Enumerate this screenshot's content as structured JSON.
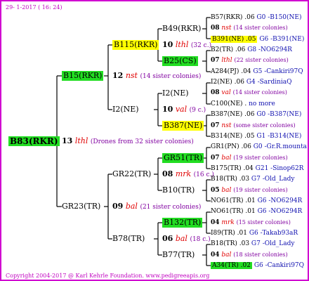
{
  "date": "29- 1-2017 ( 16: 24)",
  "copyright": "Copyright 2004-2017 @ Karl Kehrle Foundation.   www.pedigreeapis.org",
  "root": {
    "label": "B83(RKR)",
    "gen": "13",
    "mark": "lthl",
    "note": "(Drones from 32 sister colonies)"
  },
  "g1": [
    {
      "label": "B15(RKR)",
      "gen": "12",
      "mark": "nst",
      "note": "(14 sister colonies)"
    },
    {
      "label": "GR23(TR)",
      "gen": "09",
      "mark": "bal",
      "note": "(21 sister colonies)"
    }
  ],
  "g2": [
    {
      "label": "B115(RKR)",
      "gen": "10",
      "mark": "lthl",
      "note": "(32 c.)"
    },
    {
      "label": "I2(NE)",
      "gen": "10",
      "mark": "val",
      "note": "(9 c.)"
    },
    {
      "label": "GR22(TR)",
      "gen": "08",
      "mark": "mrk",
      "note": "(16 c.)"
    },
    {
      "label": "B78(TR)",
      "gen": "06",
      "mark": "bal",
      "note": "(18 c.)"
    }
  ],
  "g3": [
    {
      "label": "B49(RKR)"
    },
    {
      "label": "B25(CS)"
    },
    {
      "label": "I2(NE)"
    },
    {
      "label": "B387(NE)"
    },
    {
      "label": "GR51(TR)"
    },
    {
      "label": "B10(TR)"
    },
    {
      "label": "B132(TR)"
    },
    {
      "label": "B77(TR)"
    }
  ],
  "g4": [
    {
      "a": "B57(RKR) .06",
      "b": "G0 -B150(NE)"
    },
    {
      "gen": "08",
      "mark": "nst",
      "note": "(14 sister colonies)"
    },
    {
      "a": "B391(NE) .05",
      "b": "G6 -B391(NE)"
    },
    {
      "a": "B2(TR) .06",
      "b": "G8 -NO6294R"
    },
    {
      "gen": "07",
      "mark": "lthl",
      "note": "(22 sister colonies)"
    },
    {
      "a": "A284(PJ) .04",
      "b": "G5 -Cankiri97Q"
    },
    {
      "a": "I2(NE) .06",
      "b": "G4 -SardiniaQ"
    },
    {
      "gen": "08",
      "mark": "val",
      "note": "(14 sister colonies)"
    },
    {
      "a": "C100(NE) .",
      "b": "no more"
    },
    {
      "a": "B387(NE) .06",
      "b": "G0 -B387(NE)"
    },
    {
      "gen": "07",
      "mark": "nst",
      "note": "(some sister colonies)"
    },
    {
      "a": "B314(NE) .05",
      "b": "G1 -B314(NE)"
    },
    {
      "a": "GR1(PN) .06",
      "b": "G0 -Gr.R.mounta"
    },
    {
      "gen": "07",
      "mark": "bal",
      "note": "(19 sister colonies)"
    },
    {
      "a": "B175(TR) .04",
      "b": "G21 -Sinop62R"
    },
    {
      "a": "B18(TR) .03",
      "b": "G7 -Old_Lady"
    },
    {
      "gen": "05",
      "mark": "bal",
      "note": "(19 sister colonies)"
    },
    {
      "a": "NO61(TR) .01",
      "b": "G6 -NO6294R"
    },
    {
      "a": "NO61(TR) .01",
      "b": "G6 -NO6294R"
    },
    {
      "gen": "04",
      "mark": "mrk",
      "note": "(15 sister colonies)"
    },
    {
      "a": "I89(TR) .01",
      "b": "G6 -Takab93aR"
    },
    {
      "a": "B18(TR) .03",
      "b": "G7 -Old_Lady"
    },
    {
      "gen": "04",
      "mark": "bal",
      "note": "(18 sister colonies)"
    },
    {
      "a": "A34(TR) .02",
      "b": "G6 -Cankiri97Q"
    }
  ]
}
